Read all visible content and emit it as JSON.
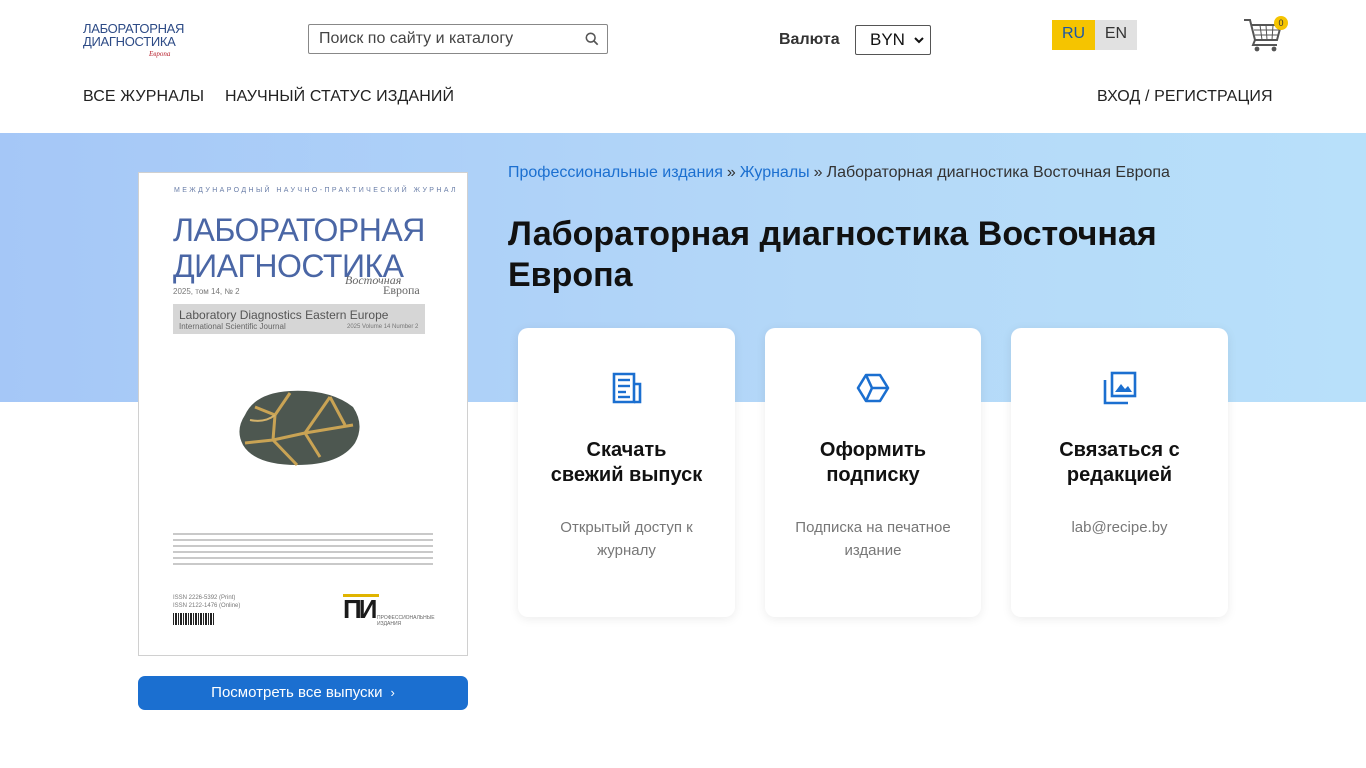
{
  "header": {
    "logo": {
      "line1": "ЛАБОРАТОРНАЯ",
      "line2": "ДИАГНОСТИКА",
      "line3": "Европа"
    },
    "search": {
      "placeholder": "Поиск по сайту и каталогу",
      "icon": "search-icon"
    },
    "currency": {
      "label": "Валюта",
      "selected": "BYN"
    },
    "languages": [
      {
        "code": "RU",
        "active": true
      },
      {
        "code": "EN",
        "active": false
      }
    ],
    "cart": {
      "count": "0",
      "icon": "cart-icon"
    },
    "nav": {
      "all_journals": "ВСЕ ЖУРНАЛЫ",
      "scientific_status": "НАУЧНЫЙ СТАТУС ИЗДАНИЙ",
      "login": "ВХОД / РЕГИСТРАЦИЯ"
    }
  },
  "breadcrumb": {
    "item1": "Профессиональные издания",
    "sep": "»",
    "item2": "Журналы",
    "item3": "Лабораторная диагностика Восточная Европа"
  },
  "title": "Лабораторная диагностика Восточная Европа",
  "cover": {
    "top": "МЕЖДУНАРОДНЫЙ НАУЧНО-ПРАКТИЧЕСКИЙ ЖУРНАЛ",
    "t1": "ЛАБОРАТОРНАЯ",
    "t2": "ДИАГНОСТИКА",
    "vos": "Восточная",
    "evr": "Европа",
    "year": "2025, том 14, № 2",
    "en_title": "Laboratory Diagnostics Eastern Europe",
    "en_sub": "International Scientific Journal",
    "en_vol": "2025 Volume 14 Number 2",
    "issn1": "ISSN 2226-5392 (Print)",
    "issn2": "ISSN 2122-1476 (Online)",
    "publisher": "ПИ",
    "publisher_sub1": "ПРОФЕССИОНАЛЬНЫЕ",
    "publisher_sub2": "ИЗДАНИЯ"
  },
  "all_issues_button": "Посмотреть все выпуски",
  "cards": [
    {
      "icon": "newspaper-icon",
      "title_l1": "Скачать",
      "title_l2": "свежий выпуск",
      "desc": "Открытый доступ к журналу"
    },
    {
      "icon": "box-icon",
      "title_l1": "Оформить",
      "title_l2": "подписку",
      "desc": "Подписка на печатное издание"
    },
    {
      "icon": "gallery-icon",
      "title_l1": "Связаться с",
      "title_l2": "редакцией",
      "desc": "lab@recipe.by"
    }
  ],
  "colors": {
    "accent": "#1b6fd0",
    "lang_active": "#f5c400",
    "hero_start": "#a5c7f7",
    "hero_end": "#b8e0fa"
  }
}
